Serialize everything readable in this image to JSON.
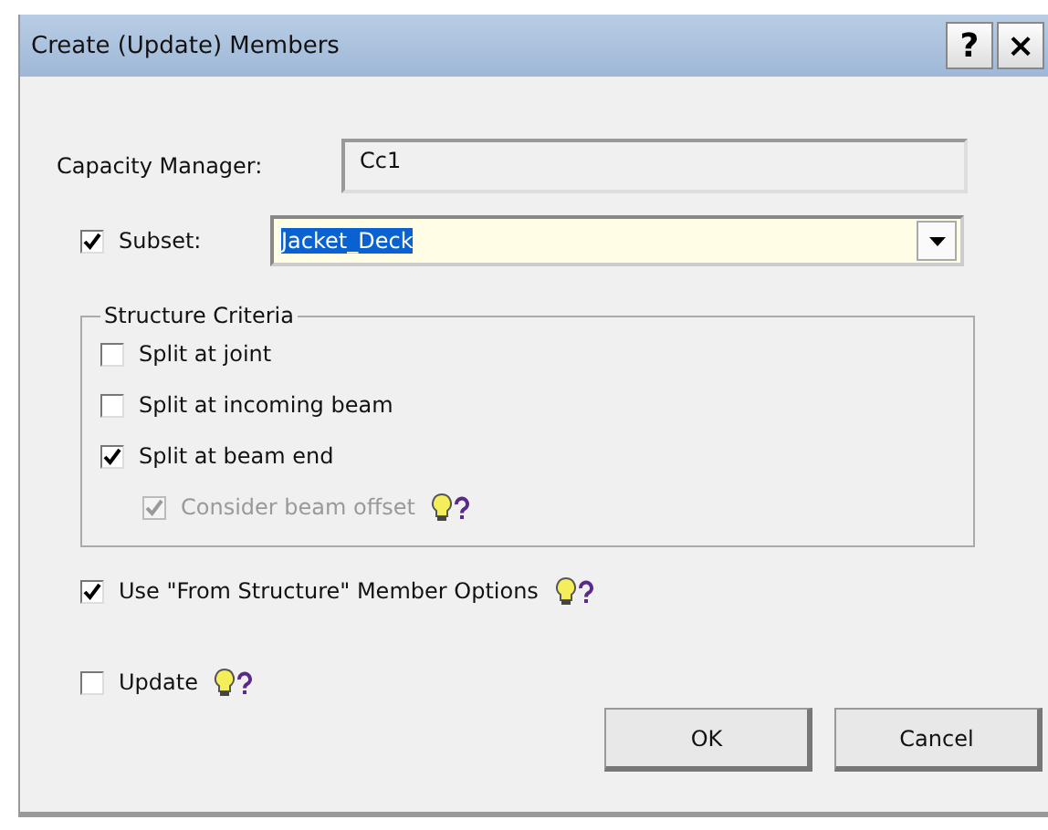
{
  "window": {
    "title": "Create (Update) Members",
    "title_buttons": [
      "?",
      "×"
    ]
  },
  "capacity_manager": {
    "label": "Capacity Manager:",
    "value": "Cc1"
  },
  "subset": {
    "label": "Subset:",
    "checked": true,
    "value": "Jacket_Deck",
    "text_selected": true
  },
  "structure_criteria": {
    "title": "Structure Criteria",
    "options": [
      {
        "label": "Split at joint",
        "checked": false,
        "disabled": false,
        "hint": false
      },
      {
        "label": "Split at incoming beam",
        "checked": false,
        "disabled": false,
        "hint": false
      },
      {
        "label": "Split at beam end",
        "checked": true,
        "disabled": false,
        "hint": false,
        "children": [
          {
            "label": "Consider beam offset",
            "checked": true,
            "disabled": true,
            "hint": true
          }
        ]
      }
    ]
  },
  "options": [
    {
      "label": "Use \"From Structure\" Member Options",
      "checked": true,
      "disabled": false,
      "hint": true
    },
    {
      "label": "Update",
      "checked": false,
      "disabled": false,
      "hint": true
    }
  ],
  "buttons": [
    {
      "label": "OK"
    },
    {
      "label": "Cancel"
    }
  ]
}
